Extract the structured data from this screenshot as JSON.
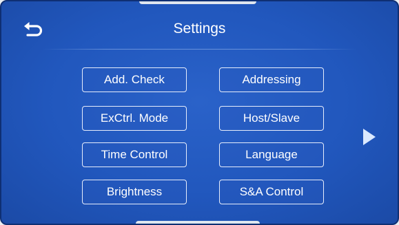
{
  "header": {
    "title": "Settings",
    "back_icon": "back-arrow-icon"
  },
  "menu": {
    "buttons": [
      {
        "label": "Add. Check"
      },
      {
        "label": "Addressing"
      },
      {
        "label": "ExCtrl. Mode"
      },
      {
        "label": "Host/Slave"
      },
      {
        "label": "Time Control"
      },
      {
        "label": "Language"
      },
      {
        "label": "Brightness"
      },
      {
        "label": "S&A Control"
      }
    ]
  },
  "navigation": {
    "next_icon": "next-page-arrow-icon"
  },
  "colors": {
    "background": "#2157bd",
    "border": "#0f2f73",
    "button_border": "#e8eefc",
    "text": "#ffffff",
    "arrow": "#dbe9ff"
  }
}
